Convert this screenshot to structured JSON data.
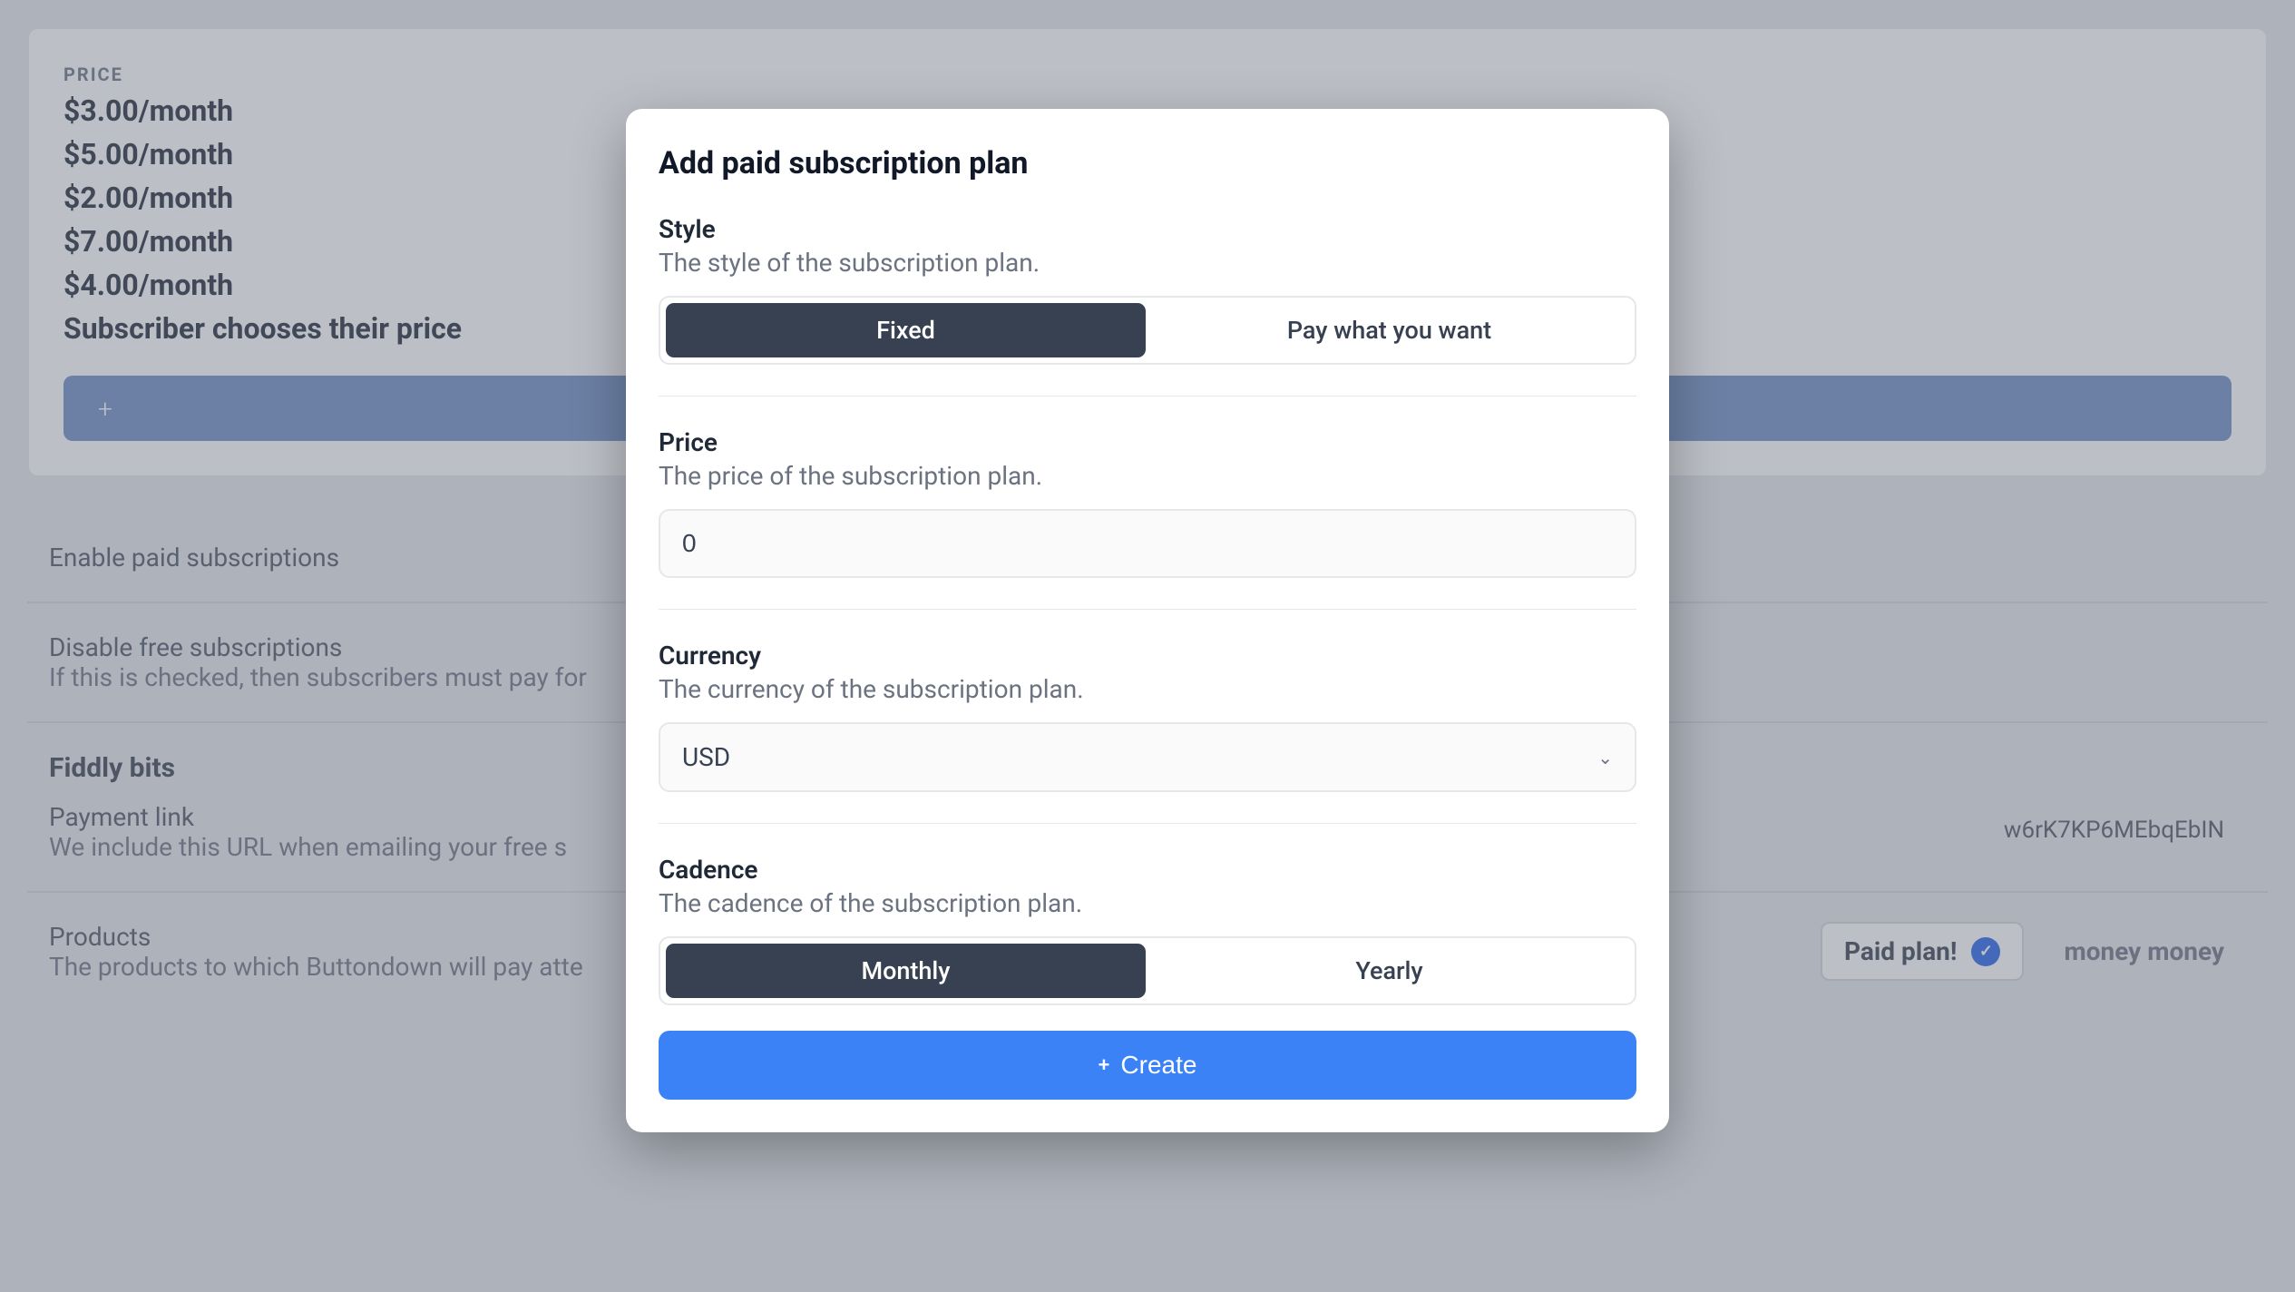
{
  "background": {
    "price_label": "PRICE",
    "prices": [
      "$3.00/month",
      "$5.00/month",
      "$2.00/month",
      "$7.00/month",
      "$4.00/month",
      "Subscriber chooses their price"
    ],
    "enable_paid": "Enable paid subscriptions",
    "disable_free_title": "Disable free subscriptions",
    "disable_free_desc": "If this is checked, then subscribers must pay for",
    "fiddly_bits": "Fiddly bits",
    "payment_link_title": "Payment link",
    "payment_link_desc": "We include this URL when emailing your free s",
    "payment_url": "w6rK7KP6MEbqEbIN",
    "products_title": "Products",
    "products_desc": "The products to which Buttondown will pay atte",
    "paid_plan_tag": "Paid plan!",
    "money_tag": "money money"
  },
  "modal": {
    "title": "Add paid subscription plan",
    "style": {
      "label": "Style",
      "description": "The style of the subscription plan.",
      "option_fixed": "Fixed",
      "option_pwyw": "Pay what you want"
    },
    "price": {
      "label": "Price",
      "description": "The price of the subscription plan.",
      "value": "0"
    },
    "currency": {
      "label": "Currency",
      "description": "The currency of the subscription plan.",
      "value": "USD"
    },
    "cadence": {
      "label": "Cadence",
      "description": "The cadence of the subscription plan.",
      "option_monthly": "Monthly",
      "option_yearly": "Yearly"
    },
    "create_button": "Create"
  }
}
